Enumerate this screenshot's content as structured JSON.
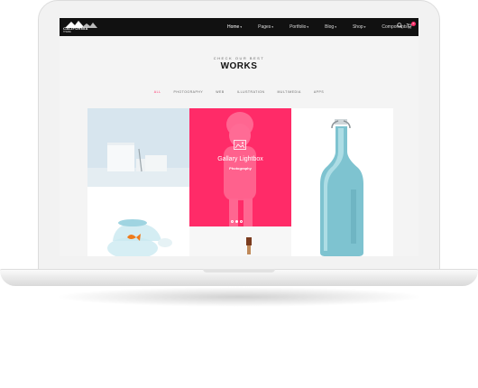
{
  "logo": {
    "text": "CALIFORNIA",
    "sub": "THEME"
  },
  "nav": {
    "items": [
      {
        "label": "Home",
        "active": true
      },
      {
        "label": "Pages",
        "active": false
      },
      {
        "label": "Portfolio",
        "active": false
      },
      {
        "label": "Blog",
        "active": false
      },
      {
        "label": "Shop",
        "active": false
      },
      {
        "label": "Components",
        "active": false
      }
    ],
    "dropdown_glyph": "▾",
    "search_icon": "search-icon",
    "cart_icon": "cart-icon",
    "cart_count": "0"
  },
  "section": {
    "eyebrow": "CHECK OUR BEST",
    "title": "WORKS"
  },
  "filters": [
    {
      "label": "ALL",
      "active": true
    },
    {
      "label": "PHOTOGRAPHY",
      "active": false
    },
    {
      "label": "WEB",
      "active": false
    },
    {
      "label": "ILLUSTRATION",
      "active": false
    },
    {
      "label": "MULTIMEDIA",
      "active": false
    },
    {
      "label": "APPS",
      "active": false
    }
  ],
  "portfolio": {
    "overlay_title": "Gallary Lightbox",
    "overlay_sub": "Photography",
    "slider_dots": 3,
    "active_dot": 2
  },
  "colors": {
    "accent": "#ff2b68",
    "nav_bg": "#111111",
    "page_bg": "#f4f4f4"
  }
}
